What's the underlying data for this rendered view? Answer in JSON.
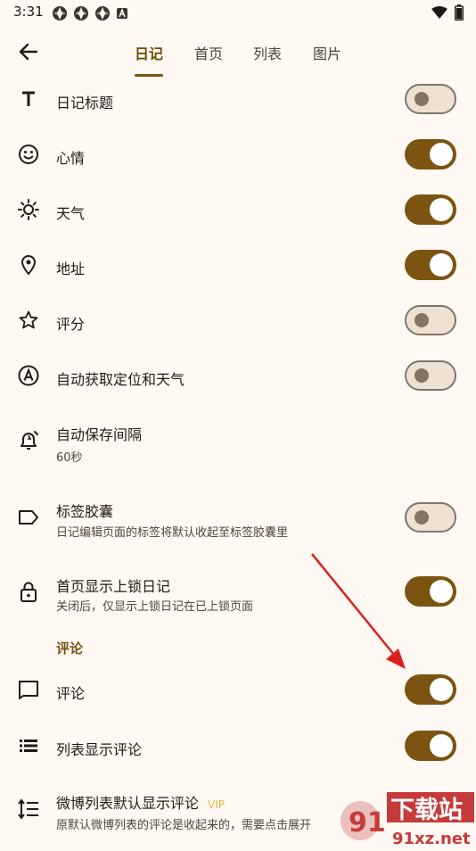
{
  "status": {
    "time": "3:31"
  },
  "tabs": [
    {
      "label": "日记",
      "active": true
    },
    {
      "label": "首页",
      "active": false
    },
    {
      "label": "列表",
      "active": false
    },
    {
      "label": "图片",
      "active": false
    }
  ],
  "settings": [
    {
      "id": "diary-title",
      "icon": "text-t-icon",
      "title": "日记标题",
      "toggle": false
    },
    {
      "id": "mood",
      "icon": "smiley-icon",
      "title": "心情",
      "toggle": true
    },
    {
      "id": "weather",
      "icon": "sun-icon",
      "title": "天气",
      "toggle": true
    },
    {
      "id": "address",
      "icon": "location-pin-icon",
      "title": "地址",
      "toggle": true
    },
    {
      "id": "rating",
      "icon": "star-icon",
      "title": "评分",
      "toggle": false
    },
    {
      "id": "auto-location-weather",
      "icon": "circle-a-icon",
      "title": "自动获取定位和天气",
      "toggle": false
    },
    {
      "id": "autosave-interval",
      "icon": "alarm-icon",
      "title": "自动保存间隔",
      "subtitle": "60秒"
    },
    {
      "id": "tag-capsule",
      "icon": "label-tag-icon",
      "title": "标签胶囊",
      "subtitle": "日记编辑页面的标签将默认收起至标签胶囊里",
      "toggle": false
    },
    {
      "id": "show-locked-diary",
      "icon": "lock-icon",
      "title": "首页显示上锁日记",
      "subtitle": "关闭后，仅显示上锁日记在已上锁页面",
      "toggle": true
    }
  ],
  "comment_section": {
    "header": "评论",
    "items": [
      {
        "id": "comments",
        "icon": "comment-icon",
        "title": "评论",
        "toggle": true
      },
      {
        "id": "list-show-comments",
        "icon": "list-icon",
        "title": "列表显示评论",
        "toggle": true
      },
      {
        "id": "weibo-default-comments",
        "icon": "line-spacing-icon",
        "title": "微博列表默认显示评论",
        "badge": "VIP",
        "subtitle": "原默认微博列表的评论是收起来的，需要点击展开"
      }
    ]
  },
  "watermark": {
    "logo_text": "下载站",
    "domain": "91xz.net"
  },
  "colors": {
    "accent": "#7a5410",
    "background": "#fff8f3",
    "switch_off_track": "#ede1d4",
    "arrow": "#d9201f"
  }
}
